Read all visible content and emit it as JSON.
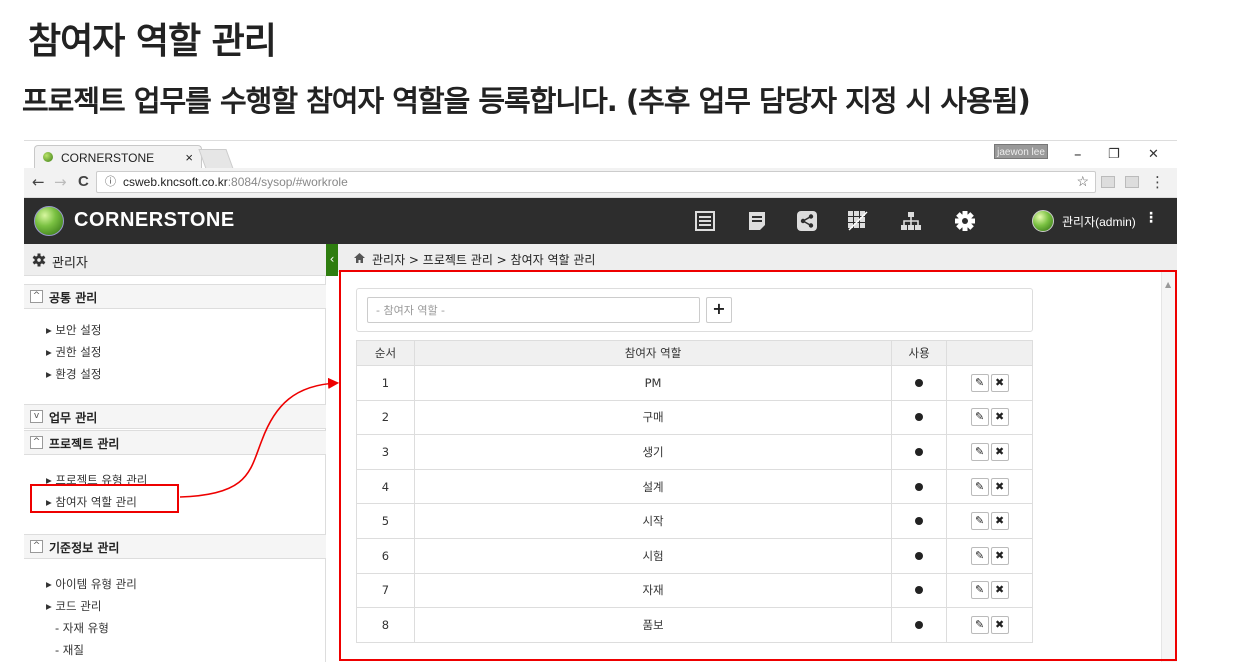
{
  "slide": {
    "title": "참여자 역할 관리",
    "subtitle": "프로젝트 업무를 수행할 참여자 역할을 등록합니다. (추후 업무 담당자 지정 시 사용됨)"
  },
  "browser": {
    "tab_title": "CORNERSTONE",
    "tab_close": "×",
    "user_chip": "jaewon lee",
    "url_host": "csweb.kncsoft.co.kr",
    "url_rest": ":8084/sysop/#workrole",
    "controls": {
      "back": "←",
      "forward": "→",
      "reload": "C",
      "info": "ⓘ",
      "star": "☆",
      "menu": "⋮",
      "minimize": "–",
      "restore": "❐",
      "close": "✕"
    }
  },
  "app": {
    "logo": "CORNERSTONE",
    "user": "관리자(admin)",
    "user_menu": "⋮",
    "header_icons": [
      "list-icon",
      "note-icon",
      "share-icon",
      "grid-icon",
      "sitemap-icon",
      "gear-icon"
    ]
  },
  "sidebar": {
    "title": "관리자",
    "collapse": "‹",
    "groups": [
      {
        "label": "공통 관리",
        "toggle": "^",
        "items": [
          "▸ 보안 설정",
          "▸ 권한 설정",
          "▸ 환경 설정"
        ]
      },
      {
        "label": "업무 관리",
        "toggle": "v",
        "items": []
      },
      {
        "label": "프로젝트 관리",
        "toggle": "^",
        "items": [
          "▸ 프로젝트 유형 관리",
          "▸ 참여자 역할 관리"
        ]
      },
      {
        "label": "기준정보 관리",
        "toggle": "^",
        "items": [
          "▸ 아이템 유형 관리",
          "▸ 코드 관리"
        ],
        "subitems": [
          "- 자재 유형",
          "- 재질"
        ]
      }
    ]
  },
  "breadcrumb": "관리자 > 프로젝트 관리 > 참여자 역할 관리",
  "form": {
    "placeholder": "- 참여자 역할 -",
    "add_label": "+"
  },
  "table": {
    "headers": [
      "순서",
      "참여자 역할",
      "사용",
      ""
    ],
    "rows": [
      {
        "seq": "1",
        "role": "PM"
      },
      {
        "seq": "2",
        "role": "구매"
      },
      {
        "seq": "3",
        "role": "생기"
      },
      {
        "seq": "4",
        "role": "설계"
      },
      {
        "seq": "5",
        "role": "시작"
      },
      {
        "seq": "6",
        "role": "시험"
      },
      {
        "seq": "7",
        "role": "자재"
      },
      {
        "seq": "8",
        "role": "품보"
      }
    ],
    "edit_glyph": "✎",
    "delete_glyph": "✖"
  },
  "colors": {
    "appbar": "#2d2d2d",
    "accent_green": "#2e7d0f",
    "annotation_red": "#e00000"
  }
}
